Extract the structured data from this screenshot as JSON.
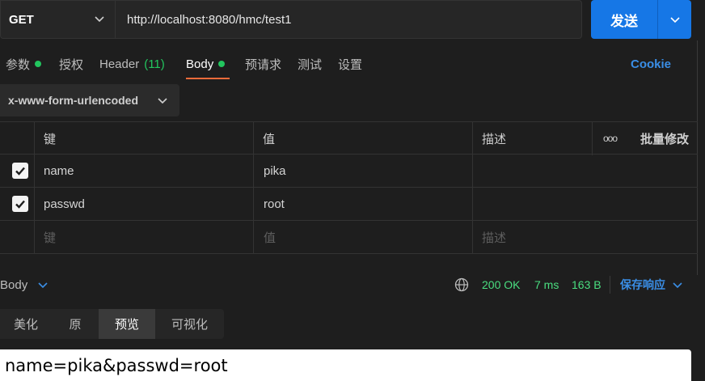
{
  "request": {
    "method": "GET",
    "url": "http://localhost:8080/hmc/test1",
    "send_label": "发送"
  },
  "tabs": {
    "params": "参数",
    "auth": "授权",
    "header": "Header",
    "header_count": "(11)",
    "body": "Body",
    "pre_request": "预请求",
    "tests": "测试",
    "settings": "设置",
    "cookie": "Cookie"
  },
  "body_type": "x-www-form-urlencoded",
  "table": {
    "headers": {
      "key": "键",
      "value": "值",
      "description": "描述",
      "more": "ooo",
      "bulk_edit": "批量修改"
    },
    "rows": [
      {
        "key": "name",
        "value": "pika",
        "description": ""
      },
      {
        "key": "passwd",
        "value": "root",
        "description": ""
      }
    ],
    "placeholders": {
      "key": "键",
      "value": "值",
      "description": "描述"
    }
  },
  "response": {
    "label": "Body",
    "status": "200 OK",
    "time": "7 ms",
    "size": "163 B",
    "save_label": "保存响应"
  },
  "view_tabs": [
    "美化",
    "原",
    "预览",
    "可视化"
  ],
  "preview_text": "name=pika&passwd=root",
  "colors": {
    "accent": "#1677e6",
    "status_green": "#22c55e",
    "active_tab_underline": "#f26b3a",
    "link_blue": "#3a8ee6"
  }
}
